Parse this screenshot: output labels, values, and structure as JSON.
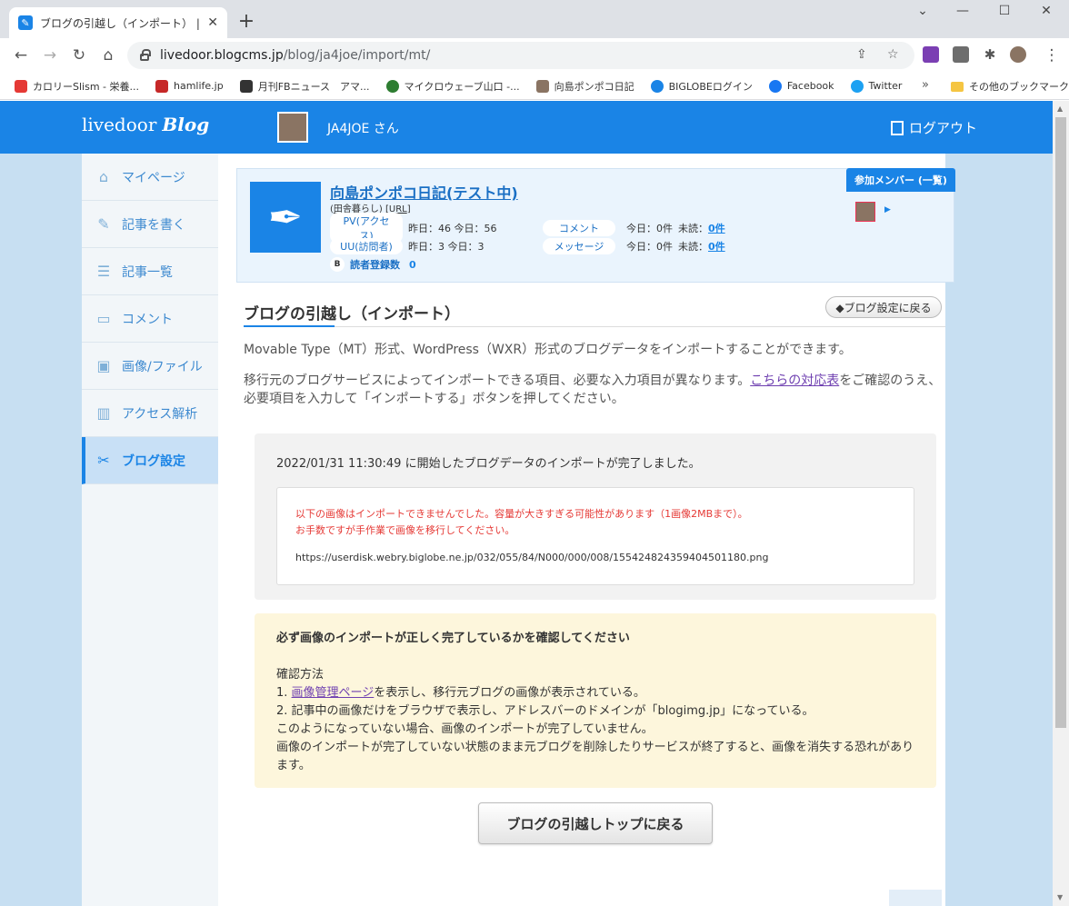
{
  "browser": {
    "tab_title": "ブログの引越し（インポート） | livedoor",
    "url_host": "livedoor.blogcms.jp",
    "url_path": "/blog/ja4joe/import/mt/",
    "bookmarks": [
      {
        "label": "カロリーSlism - 栄養...",
        "color": "#e53935"
      },
      {
        "label": "hamlife.jp",
        "color": "#c62828"
      },
      {
        "label": "月刊FBニュース　アマ...",
        "color": "#333333"
      },
      {
        "label": "マイクロウェーブ山口 -...",
        "color": "#2e7d32"
      },
      {
        "label": "向島ポンポコ日記",
        "color": "#8a7463"
      },
      {
        "label": "BIGLOBEログイン",
        "color": "#1a84e6"
      },
      {
        "label": "Facebook",
        "color": "#1877f2"
      },
      {
        "label": "Twitter",
        "color": "#1da1f2"
      }
    ],
    "bookmarks_more": "»",
    "bookmarks_other": "その他のブックマーク"
  },
  "header": {
    "logo_main": "livedoor",
    "logo_blog": "Blog",
    "user": "JA4JOE さん",
    "logout": "ログアウト"
  },
  "sidebar": {
    "items": [
      {
        "label": "マイページ",
        "icon": "⌂"
      },
      {
        "label": "記事を書く",
        "icon": "✎"
      },
      {
        "label": "記事一覧",
        "icon": "☰"
      },
      {
        "label": "コメント",
        "icon": "▭"
      },
      {
        "label": "画像/ファイル",
        "icon": "▣"
      },
      {
        "label": "アクセス解析",
        "icon": "▥"
      },
      {
        "label": "ブログ設定",
        "icon": "✂"
      }
    ]
  },
  "blog": {
    "name": "向島ポンポコ日記(テスト中)",
    "sub_a": "田舎暮らし",
    "sub_b": "URL",
    "pv_label": "PV(アクセス)",
    "pv_text": "昨日：46 今日：56",
    "uu_label": "UU(訪問者)",
    "uu_text": "昨日：3 今日：3",
    "reader_label": "読者登録数",
    "reader_count": "0",
    "comment_label": "コメント",
    "comment_today": "今日：0件",
    "comment_unread_label": "未読：",
    "comment_unread": "0件",
    "message_label": "メッセージ",
    "message_today": "今日：0件",
    "message_unread_label": "未読：",
    "message_unread": "0件",
    "member_button": "参加メンバー (一覧)"
  },
  "page": {
    "title": "ブログの引越し（インポート）",
    "back_settings": "◆ブログ設定に戻る",
    "para1": "Movable Type（MT）形式、WordPress（WXR）形式のブログデータをインポートすることができます。",
    "para2_before": "移行元のブログサービスによってインポートできる項目、必要な入力項目が異なります。",
    "para2_link": "こちらの対応表",
    "para2_after": "をご確認のうえ、",
    "para2_line2": "必要項目を入力して「インポートする」ボタンを押してください。",
    "result": "2022/01/31 11:30:49 に開始したブログデータのインポートが完了しました。",
    "error_line1": "以下の画像はインポートできませんでした。容量が大きすぎる可能性があります（1画像2MBまで）。",
    "error_line2": "お手数ですが手作業で画像を移行してください。",
    "image_url": "https://userdisk.webry.biglobe.ne.jp/032/055/84/N000/000/008/155424824359404501180.png",
    "notice_head": "必ず画像のインポートが正しく完了しているかを確認してください",
    "notice_method": "確認方法",
    "notice_1_prefix": "1. ",
    "notice_1_link": "画像管理ページ",
    "notice_1_rest": "を表示し、移行元ブログの画像が表示されている。",
    "notice_2": "2. 記事中の画像だけをブラウザで表示し、アドレスバーのドメインが「blogimg.jp」になっている。",
    "notice_3": "このようになっていない場合、画像のインポートが完了していません。",
    "notice_4": "画像のインポートが完了していない状態のまま元ブログを削除したりサービスが終了すると、画像を消失する恐れがあります。",
    "back_top": "ブログの引越しトップに戻る"
  }
}
